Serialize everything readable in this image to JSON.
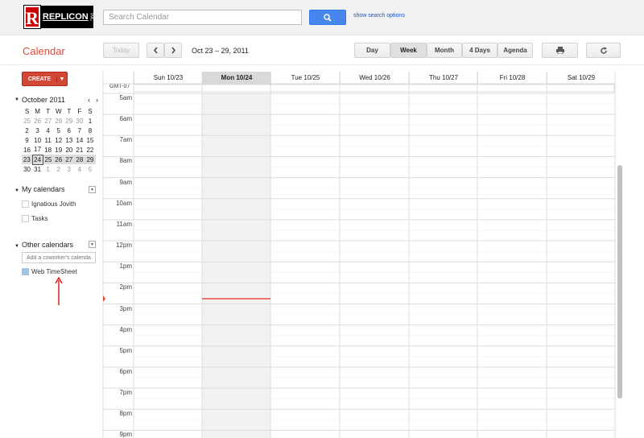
{
  "logo": {
    "text": "REPLICON",
    "suffix": "INC"
  },
  "search": {
    "placeholder": "Search Calendar",
    "options_link": "show search options"
  },
  "app": {
    "title": "Calendar"
  },
  "toolbar": {
    "today": "Today",
    "date_range": "Oct 23 – 29, 2011",
    "views": [
      "Day",
      "Week",
      "Month",
      "4 Days",
      "Agenda"
    ],
    "active_view": "Week"
  },
  "create": {
    "label": "CREATE"
  },
  "minical": {
    "month": "October 2011",
    "weekdays": [
      "S",
      "M",
      "T",
      "W",
      "T",
      "F",
      "S"
    ],
    "weeks": [
      [
        "25",
        "26",
        "27",
        "28",
        "29",
        "30",
        "1"
      ],
      [
        "2",
        "3",
        "4",
        "5",
        "6",
        "7",
        "8"
      ],
      [
        "9",
        "10",
        "11",
        "12",
        "13",
        "14",
        "15"
      ],
      [
        "16",
        "17",
        "18",
        "19",
        "20",
        "21",
        "22"
      ],
      [
        "23",
        "24",
        "25",
        "26",
        "27",
        "28",
        "29"
      ],
      [
        "30",
        "31",
        "1",
        "2",
        "3",
        "4",
        "5"
      ]
    ],
    "selected": "24"
  },
  "my_calendars": {
    "title": "My calendars",
    "items": [
      "Ignatious Jovith",
      "Tasks"
    ]
  },
  "other_calendars": {
    "title": "Other calendars",
    "placeholder": "Add a coworker's calendar",
    "items": [
      "Web TimeSheet"
    ]
  },
  "grid": {
    "timezone": "GMT-07",
    "days": [
      "Sun 10/23",
      "Mon 10/24",
      "Tue 10/25",
      "Wed 10/26",
      "Thu 10/27",
      "Fri 10/28",
      "Sat 10/29"
    ],
    "today_index": 1,
    "hours": [
      "5am",
      "6am",
      "7am",
      "8am",
      "9am",
      "10am",
      "11am",
      "12pm",
      "1pm",
      "2pm",
      "3pm",
      "4pm",
      "5pm",
      "6pm",
      "7pm",
      "8pm",
      "9pm"
    ]
  },
  "colors": {
    "accent": "#dd4b39",
    "create": "#d14836",
    "search": "#4787ed",
    "web_timesheet": "#9fc6e7",
    "now_line": "#e44b3c"
  }
}
